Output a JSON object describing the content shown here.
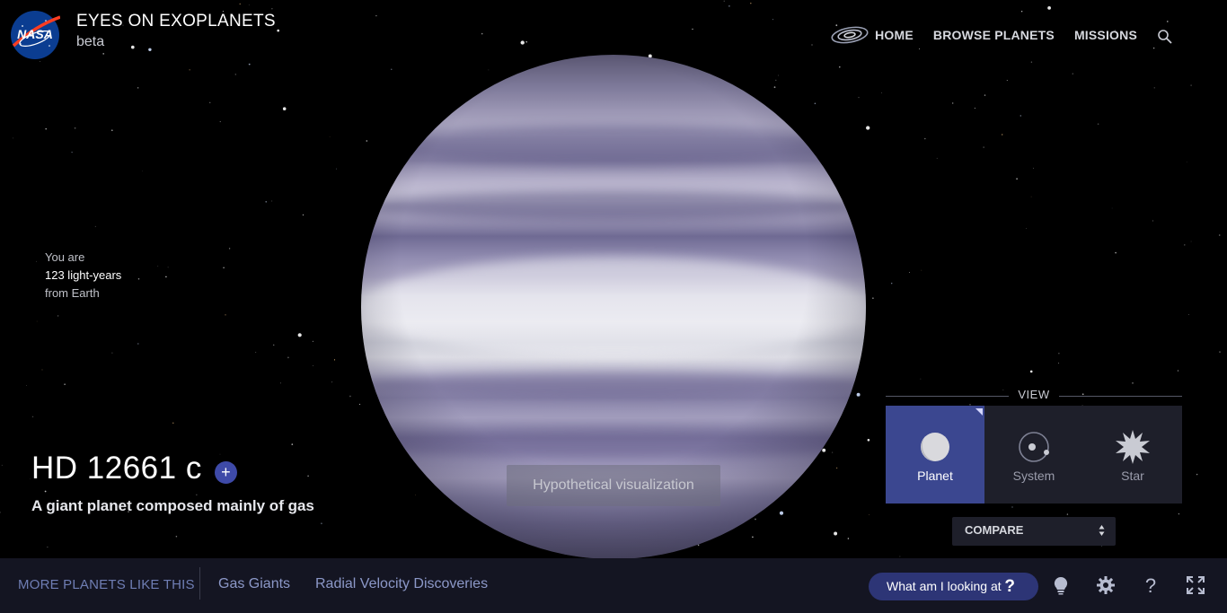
{
  "header": {
    "logo_text": "NASA",
    "title": "EYES ON EXOPLANETS",
    "subtitle": "beta"
  },
  "nav": {
    "items": [
      "HOME",
      "BROWSE PLANETS",
      "MISSIONS"
    ],
    "icons": [
      "galaxy-icon",
      "search-icon"
    ]
  },
  "distance": {
    "prefix": "You are",
    "value": "123 light-years",
    "suffix": "from Earth"
  },
  "planet": {
    "name": "HD 12661 c",
    "add_label": "+",
    "description": "A giant planet composed mainly of gas",
    "visualization_note": "Hypothetical visualization"
  },
  "view": {
    "label": "VIEW",
    "options": [
      {
        "label": "Planet",
        "icon": "planet-icon",
        "active": true
      },
      {
        "label": "System",
        "icon": "system-icon",
        "active": false
      },
      {
        "label": "Star",
        "icon": "star-icon",
        "active": false
      }
    ],
    "compare_label": "COMPARE"
  },
  "footer": {
    "more_label": "MORE PLANETS LIKE THIS",
    "links": [
      "Gas Giants",
      "Radial Velocity Discoveries"
    ],
    "help_button": "What am I looking at",
    "help_glyph": "?",
    "icons": [
      "lightbulb-icon",
      "settings-gear-icon",
      "help-icon",
      "fullscreen-icon"
    ]
  },
  "colors": {
    "accent": "#3b4790",
    "footer_bg": "#141522",
    "panel_bg": "#1e1f2a",
    "link": "#8c98c8"
  }
}
